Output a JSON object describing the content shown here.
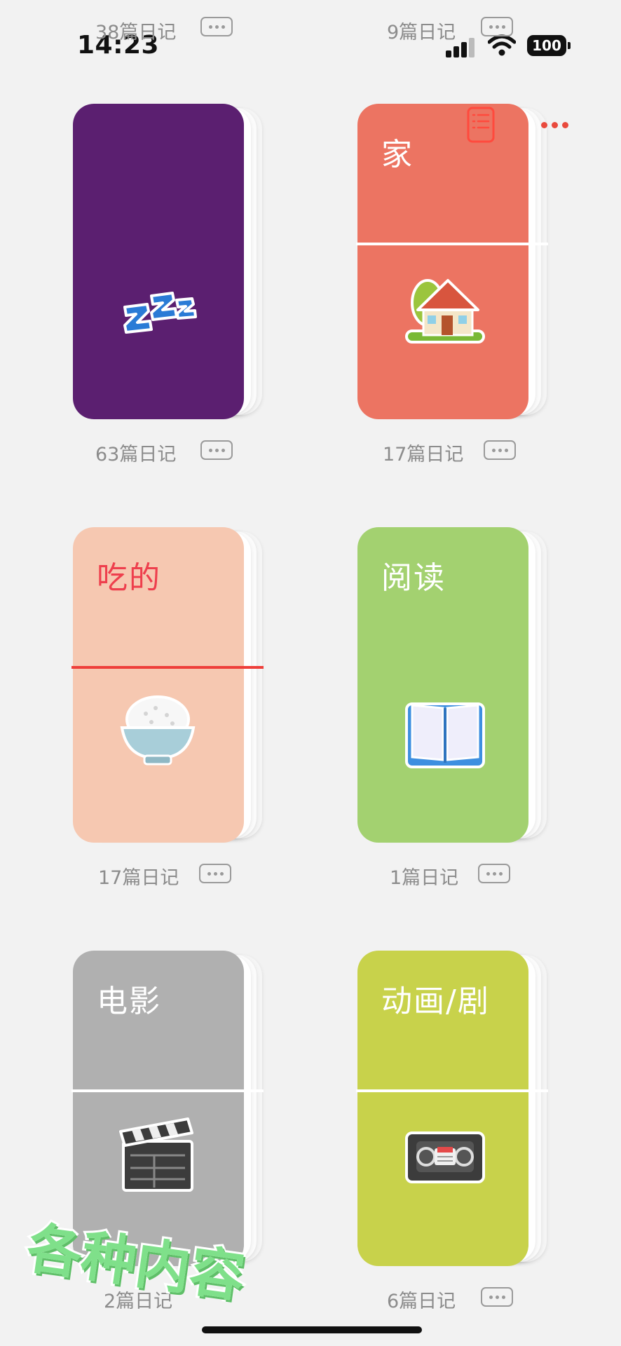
{
  "status_bar": {
    "time": "14:23",
    "battery": "100"
  },
  "top_partial": [
    {
      "count": "38篇日记"
    },
    {
      "count": "9篇日记"
    }
  ],
  "notebooks": [
    {
      "title": "",
      "count": "63篇日记",
      "color": "#5b1f70",
      "icon": "zzz-icon"
    },
    {
      "title": "家",
      "count": "17篇日记",
      "color": "#ec7462",
      "icon": "house-icon"
    },
    {
      "title": "吃的",
      "count": "17篇日记",
      "color": "#f6c8b1",
      "icon": "rice-bowl-icon"
    },
    {
      "title": "阅读",
      "count": "1篇日记",
      "color": "#a3d170",
      "icon": "open-book-icon"
    },
    {
      "title": "电影",
      "count": "2篇日记",
      "color": "#b0b0b0",
      "icon": "clapperboard-icon"
    },
    {
      "title": "动画/剧",
      "count": "6篇日记",
      "color": "#c8d24b",
      "icon": "videocassette-icon"
    }
  ],
  "overlay": {
    "text": "各种内容"
  }
}
